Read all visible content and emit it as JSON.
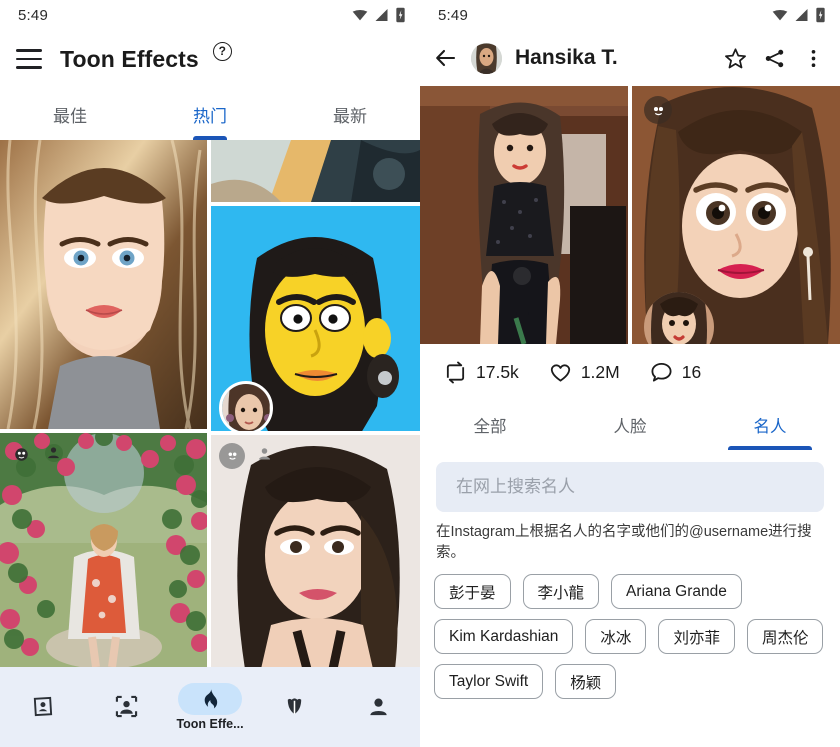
{
  "left": {
    "status": {
      "time": "5:49",
      "icons": [
        "wifi-icon",
        "signal-icon",
        "battery-icon"
      ]
    },
    "appbar": {
      "menu_icon": "hamburger-menu-icon",
      "title": "Toon Effects",
      "help_label": "?"
    },
    "tabs": [
      {
        "label": "最佳",
        "active": false
      },
      {
        "label": "热门",
        "active": true
      },
      {
        "label": "最新",
        "active": false
      }
    ],
    "grid": [
      {
        "name": "cartoon-portrait-blonde",
        "badges": []
      },
      {
        "name": "artwork-crop-top",
        "badges": []
      },
      {
        "name": "simpsons-style-portrait",
        "badges": [
          "face-thumbnail"
        ]
      },
      {
        "name": "rose-garden-photo",
        "badges": [
          "toon-face-icon",
          "person-icon"
        ]
      },
      {
        "name": "glamour-toon-portrait",
        "badges": [
          "toon-face-icon",
          "person-icon"
        ]
      }
    ],
    "bottomnav": [
      {
        "icon": "photo-frame-icon",
        "label": "",
        "selected": false
      },
      {
        "icon": "face-group-icon",
        "label": "",
        "selected": false
      },
      {
        "icon": "flame-icon",
        "label": "Toon Effe...",
        "selected": true
      },
      {
        "icon": "tulip-icon",
        "label": "",
        "selected": false
      },
      {
        "icon": "person-icon",
        "label": "",
        "selected": false
      }
    ]
  },
  "right": {
    "status": {
      "time": "5:49",
      "icons": [
        "wifi-icon",
        "signal-icon",
        "battery-icon"
      ]
    },
    "appbar": {
      "back_icon": "back-arrow-icon",
      "avatar": "user-avatar",
      "title": "Hansika T.",
      "actions": [
        "star-icon",
        "share-icon",
        "more-vertical-icon"
      ]
    },
    "media": [
      {
        "name": "original-photo",
        "badges": []
      },
      {
        "name": "toon-result-photo",
        "badges": [
          "toon-face-icon",
          "source-thumbnail"
        ]
      }
    ],
    "stats": [
      {
        "icon": "repost-icon",
        "value": "17.5k"
      },
      {
        "icon": "heart-icon",
        "value": "1.2M"
      },
      {
        "icon": "comment-icon",
        "value": "16"
      }
    ],
    "tabs": [
      {
        "label": "全部",
        "active": false
      },
      {
        "label": "人脸",
        "active": false
      },
      {
        "label": "名人",
        "active": true
      }
    ],
    "search": {
      "value": "",
      "placeholder": "在网上搜索名人"
    },
    "hint": "在Instagram上根据名人的名字或他们的@username进行搜索。",
    "chips": [
      "彭于晏",
      "李小龍",
      "Ariana Grande",
      "Kim Kardashian",
      "冰冰",
      "刘亦菲",
      "周杰伦",
      "Taylor Swift",
      "杨颖"
    ]
  },
  "colors": {
    "accent_blue": "#1a66c9",
    "indicator_blue": "#1b55b7",
    "nav_background": "#e9eef8",
    "nav_pill": "#c9e3fb",
    "search_background": "#e7ecf5",
    "chip_border": "#9aa0a6"
  }
}
